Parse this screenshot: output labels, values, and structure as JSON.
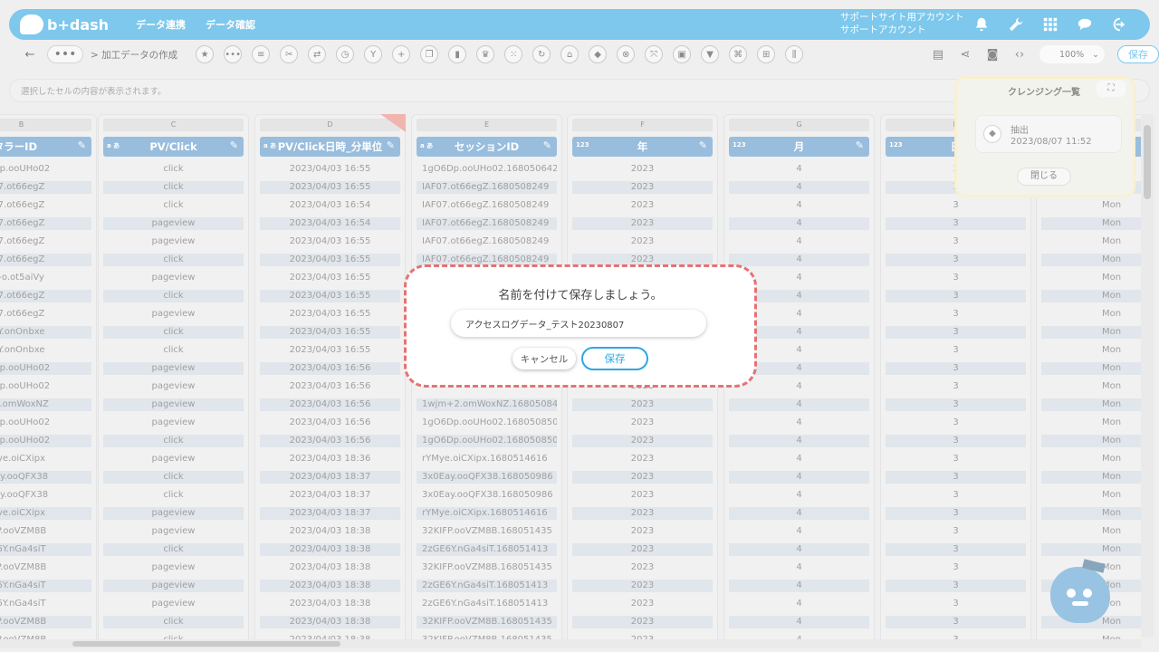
{
  "header": {
    "logo_text": "b+dash",
    "nav": [
      "データ連携",
      "データ確認"
    ],
    "account_line1": "サポートサイト用アカウント",
    "account_line2": "サポートアカウント",
    "icons": [
      "bell-icon",
      "wrench-icon",
      "grid-icon",
      "chat-icon",
      "logout-icon"
    ]
  },
  "toolbar": {
    "back_label": "←",
    "more_label": "•••",
    "breadcrumb": "> 加工データの作成",
    "tool_glyphs": [
      "★",
      "•••",
      "≡",
      "✂",
      "⇄",
      "◷",
      "Y",
      "+",
      "❐",
      "▮",
      "♛",
      "⁙",
      "↻",
      "⌂",
      "◆",
      "⊗",
      "⤧",
      "▣",
      "▼",
      "⌘",
      "⊞",
      "⫼"
    ],
    "zoom": "100%",
    "save_label": "保存"
  },
  "cell_bar": {
    "placeholder": "選択したセルの内容が表示されます。"
  },
  "columns": [
    {
      "letter": "B",
      "name": "タラーID",
      "type": "",
      "cells": [
        "Dp.ooUHo02",
        "7.ot66egZ",
        "7.ot66egZ",
        "7.ot66egZ",
        "7.ot66egZ",
        "7.ot66egZ",
        "-o.ot5aiVy",
        "7.ot66egZ",
        "7.ot66egZ",
        "Y.onOnbxe",
        "Y.onOnbxe",
        "Dp.ooUHo02",
        "Dp.ooUHo02",
        "2.omWoxNZ",
        "Dp.ooUHo02",
        "Dp.ooUHo02",
        "ye.oiCXipx",
        "ay.ooQFX38",
        "ay.ooQFX38",
        "ye.oiCXipx",
        "P.ooVZM8B",
        "6Y.nGa4siT",
        "P.ooVZM8B",
        "6Y.nGa4siT",
        "6Y.nGa4siT",
        "P.ooVZM8B",
        "P.ooVZM8B"
      ]
    },
    {
      "letter": "C",
      "name": "PV/Click",
      "type": "a あ",
      "cells": [
        "click",
        "click",
        "click",
        "pageview",
        "pageview",
        "click",
        "pageview",
        "click",
        "pageview",
        "click",
        "click",
        "pageview",
        "pageview",
        "pageview",
        "pageview",
        "click",
        "pageview",
        "click",
        "click",
        "pageview",
        "pageview",
        "click",
        "pageview",
        "pageview",
        "pageview",
        "click",
        "click"
      ]
    },
    {
      "letter": "D",
      "name": "PV/Click日時_分単位",
      "type": "a あ",
      "cells": [
        "2023/04/03 16:55",
        "2023/04/03 16:55",
        "2023/04/03 16:54",
        "2023/04/03 16:54",
        "2023/04/03 16:55",
        "2023/04/03 16:55",
        "2023/04/03 16:55",
        "2023/04/03 16:55",
        "2023/04/03 16:55",
        "2023/04/03 16:55",
        "2023/04/03 16:55",
        "2023/04/03 16:56",
        "2023/04/03 16:56",
        "2023/04/03 16:56",
        "2023/04/03 16:56",
        "2023/04/03 16:56",
        "2023/04/03 18:36",
        "2023/04/03 18:37",
        "2023/04/03 18:37",
        "2023/04/03 18:37",
        "2023/04/03 18:38",
        "2023/04/03 18:38",
        "2023/04/03 18:38",
        "2023/04/03 18:38",
        "2023/04/03 18:38",
        "2023/04/03 18:38",
        "2023/04/03 18:38"
      ]
    },
    {
      "letter": "E",
      "name": "セッションID",
      "type": "a あ",
      "cells": [
        "1gO6Dp.ooUHo02.1680506424",
        "IAF07.ot66egZ.1680508249",
        "IAF07.ot66egZ.1680508249",
        "IAF07.ot66egZ.1680508249",
        "IAF07.ot66egZ.1680508249",
        "IAF07.ot66egZ.1680508249",
        "",
        "",
        "",
        "",
        "",
        "",
        "",
        "1wjm+2.omWoxNZ.168050840",
        "1gO6Dp.ooUHo02.168050850",
        "1gO6Dp.ooUHo02.168050850",
        "rYMye.oiCXipx.1680514616",
        "3x0Eay.ooQFX38.168050986",
        "3x0Eay.ooQFX38.168050986",
        "rYMye.oiCXipx.1680514616",
        "32KIFP.ooVZM8B.168051435",
        "2zGE6Y.nGa4siT.168051413",
        "32KIFP.ooVZM8B.168051435",
        "2zGE6Y.nGa4siT.168051413",
        "2zGE6Y.nGa4siT.168051413",
        "32KIFP.ooVZM8B.168051435",
        "32KIFP.ooVZM8B.168051435"
      ]
    },
    {
      "letter": "F",
      "name": "年",
      "type": "123",
      "cells": [
        "2023",
        "2023",
        "2023",
        "2023",
        "2023",
        "2023",
        "2023",
        "2023",
        "2023",
        "2023",
        "2023",
        "2023",
        "2023",
        "2023",
        "2023",
        "2023",
        "2023",
        "2023",
        "2023",
        "2023",
        "2023",
        "2023",
        "2023",
        "2023",
        "2023",
        "2023",
        "2023"
      ]
    },
    {
      "letter": "G",
      "name": "月",
      "type": "123",
      "cells": [
        "4",
        "4",
        "4",
        "4",
        "4",
        "4",
        "4",
        "4",
        "4",
        "4",
        "4",
        "4",
        "4",
        "4",
        "4",
        "4",
        "4",
        "4",
        "4",
        "4",
        "4",
        "4",
        "4",
        "4",
        "4",
        "4",
        "4"
      ]
    },
    {
      "letter": "H",
      "name": "日",
      "type": "123",
      "cells": [
        "3",
        "3",
        "3",
        "3",
        "3",
        "3",
        "3",
        "3",
        "3",
        "3",
        "3",
        "3",
        "3",
        "3",
        "3",
        "3",
        "3",
        "3",
        "3",
        "3",
        "3",
        "3",
        "3",
        "3",
        "3",
        "3",
        "3"
      ]
    },
    {
      "letter": "I",
      "name": "",
      "type": "",
      "cells": [
        "Mon",
        "Mon",
        "Mon",
        "Mon",
        "Mon",
        "Mon",
        "Mon",
        "Mon",
        "Mon",
        "Mon",
        "Mon",
        "Mon",
        "Mon",
        "Mon",
        "Mon",
        "Mon",
        "Mon",
        "Mon",
        "Mon",
        "Mon",
        "Mon",
        "Mon",
        "Mon",
        "Mon",
        "Mon",
        "Mon",
        "Mon"
      ]
    }
  ],
  "cleansing_panel": {
    "title": "クレンジング一覧",
    "expand_label": "⛶",
    "step_name": "抽出",
    "step_date": "2023/08/07 11:52",
    "close_label": "閉じる"
  },
  "dialog": {
    "title": "名前を付けて保存しましょう。",
    "name_value": "アクセスログデータ_テスト20230807",
    "cancel_label": "キャンセル",
    "save_label": "保存",
    "border_color": "#e57373",
    "accent_color": "#2ea7e0"
  }
}
